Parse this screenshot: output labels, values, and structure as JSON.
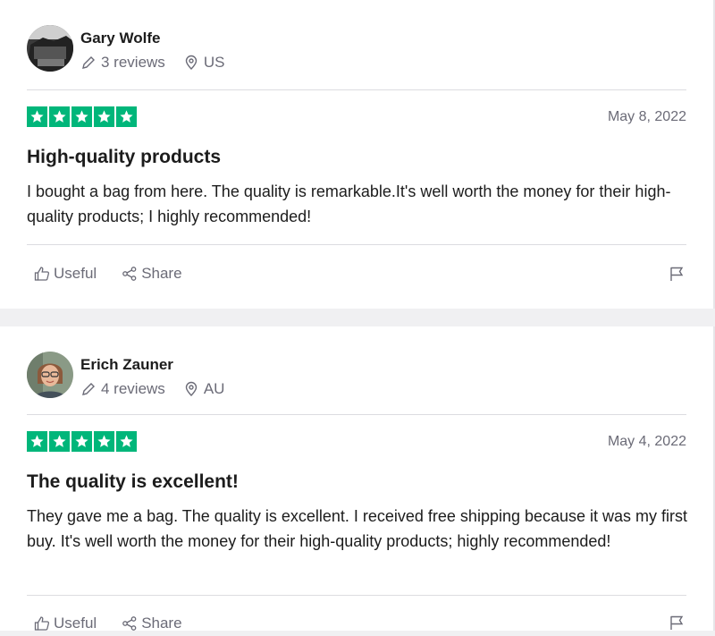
{
  "reviews": [
    {
      "reviewer": {
        "name": "Gary Wolfe",
        "reviews_count": "3 reviews",
        "country": "US"
      },
      "rating": 5,
      "date": "May 8, 2022",
      "title": "High-quality products",
      "body": "I bought a bag from here. The quality is remarkable.It's well worth the money for their high-quality products; I highly recommended!",
      "actions": {
        "useful": "Useful",
        "share": "Share"
      }
    },
    {
      "reviewer": {
        "name": "Erich Zauner",
        "reviews_count": "4 reviews",
        "country": "AU"
      },
      "rating": 5,
      "date": "May 4, 2022",
      "title": "The quality is excellent!",
      "body": "They gave me a bag. The quality is excellent. I received free shipping because it was my first buy. It's well worth the money for their high-quality products; highly recommended!",
      "actions": {
        "useful": "Useful",
        "share": "Share"
      }
    }
  ],
  "colors": {
    "star_green": "#00b67a",
    "muted_text": "#6b6b77",
    "divider": "#dcdce0"
  }
}
